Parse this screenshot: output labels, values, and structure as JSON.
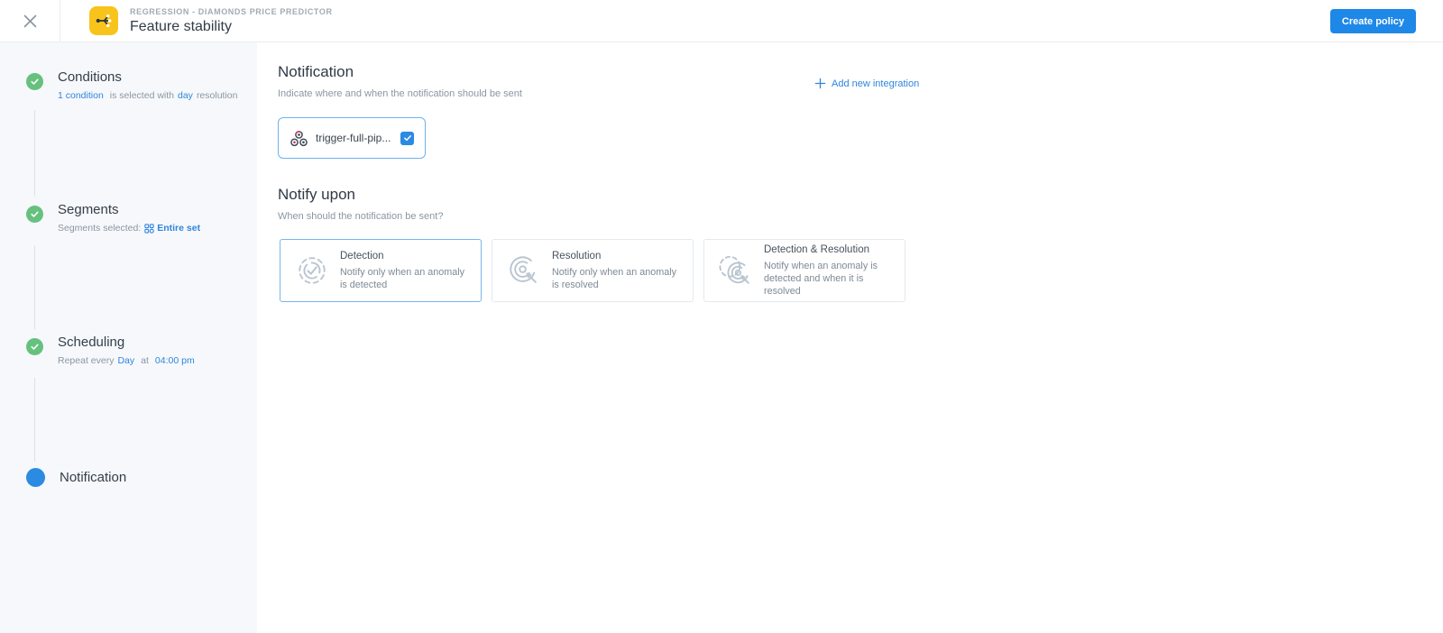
{
  "colors": {
    "accent_blue": "#2b8ae2",
    "link_blue": "#2f86de",
    "button_blue": "#1e88e8",
    "success_green": "#66c17e",
    "policy_yellow": "#f8c41c",
    "sidebar_bg": "#f6f8fb",
    "selected_border_blue": "#77b5ec",
    "muted_icon_gray": "#b9c5d1",
    "webhook_dark": "#3e4a57",
    "webhook_red": "#c9385f"
  },
  "header": {
    "eyebrow": "REGRESSION - DIAMONDS PRICE PREDICTOR",
    "title": "Feature stability",
    "create_button_label": "Create policy",
    "icons": [
      "close-icon",
      "feature-branch-icon"
    ]
  },
  "steps": {
    "conditions": {
      "title": "Conditions",
      "state": "completed",
      "sub_link_1": "1 condition",
      "sub_text_1": "is selected with",
      "sub_link_2": "day",
      "sub_text_2": "resolution"
    },
    "segments": {
      "title": "Segments",
      "state": "completed",
      "sub_text_1": "Segments selected:",
      "sub_link_1": "Entire set",
      "sub_icon": "segments-grid-icon"
    },
    "scheduling": {
      "title": "Scheduling",
      "state": "completed",
      "sub_text_1": "Repeat every",
      "sub_link_1": "Day",
      "sub_text_2": "at",
      "sub_link_2": "04:00 pm"
    },
    "notification": {
      "title": "Notification",
      "state": "active"
    }
  },
  "main": {
    "notification_section": {
      "title": "Notification",
      "subtitle": "Indicate where and when the notification should be sent",
      "add_integration_label": "Add new integration",
      "integration": {
        "name": "trigger-full-pip...",
        "checked": true,
        "icon": "webhook-icon"
      }
    },
    "notify_upon_section": {
      "title": "Notify upon",
      "subtitle": "When should the notification be sent?",
      "options": [
        {
          "title": "Detection",
          "description": "Notify only when an anomaly is detected",
          "selected": true,
          "icon": "detection-target-check-icon"
        },
        {
          "title": "Resolution",
          "description": "Notify only when an anomaly is resolved",
          "selected": false,
          "icon": "resolution-target-arrow-icon"
        },
        {
          "title": "Detection & Resolution",
          "description": "Notify when an anomaly is detected and when it is resolved",
          "selected": false,
          "icon": "detection-and-resolution-icon"
        }
      ]
    }
  }
}
